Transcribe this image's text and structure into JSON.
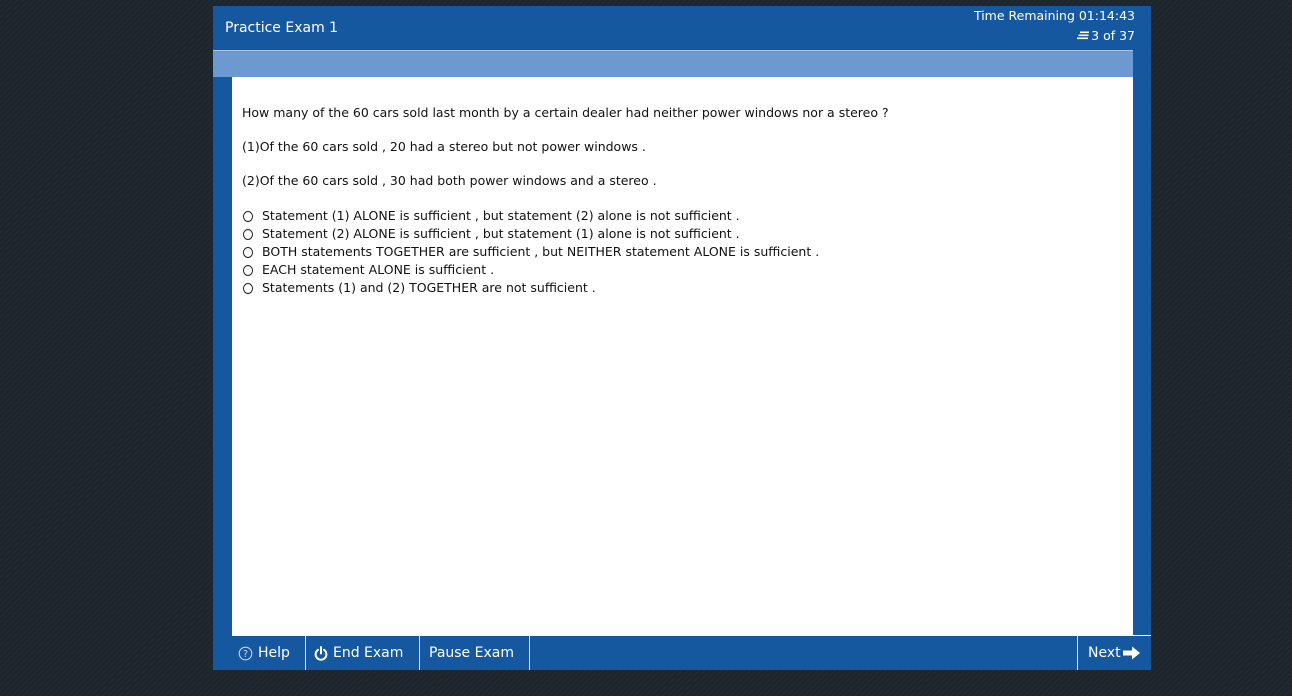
{
  "header": {
    "title": "Practice Exam 1",
    "time_remaining": "Time Remaining 01:14:43",
    "progress": "3 of 37"
  },
  "question": {
    "stem": "How many of the 60 cars sold last month by a certain dealer had neither power windows nor a stereo ?",
    "statement_1": "(1)Of the 60 cars sold , 20 had a stereo but not power windows .",
    "statement_2": "(2)Of the 60 cars sold , 30 had both power windows and a stereo .",
    "choices": [
      "Statement (1) ALONE is sufficient , but statement (2) alone is not sufficient .",
      "Statement (2) ALONE is sufficient , but statement (1) alone is not sufficient .",
      "BOTH statements TOGETHER are sufficient , but NEITHER statement ALONE is sufficient .",
      "EACH statement ALONE is sufficient .",
      "Statements (1) and (2) TOGETHER are not sufficient ."
    ]
  },
  "footer": {
    "help_label": "Help",
    "end_exam_label": "End Exam",
    "pause_exam_label": "Pause Exam",
    "next_label": "Next"
  },
  "icons": {
    "help": "help-circle-icon",
    "end_exam": "power-icon",
    "next": "arrow-right-icon",
    "progress": "review-list-icon"
  },
  "colors": {
    "frame_blue": "#1658a0",
    "subheader_blue": "#6b99d0",
    "background": "#1e262d"
  }
}
